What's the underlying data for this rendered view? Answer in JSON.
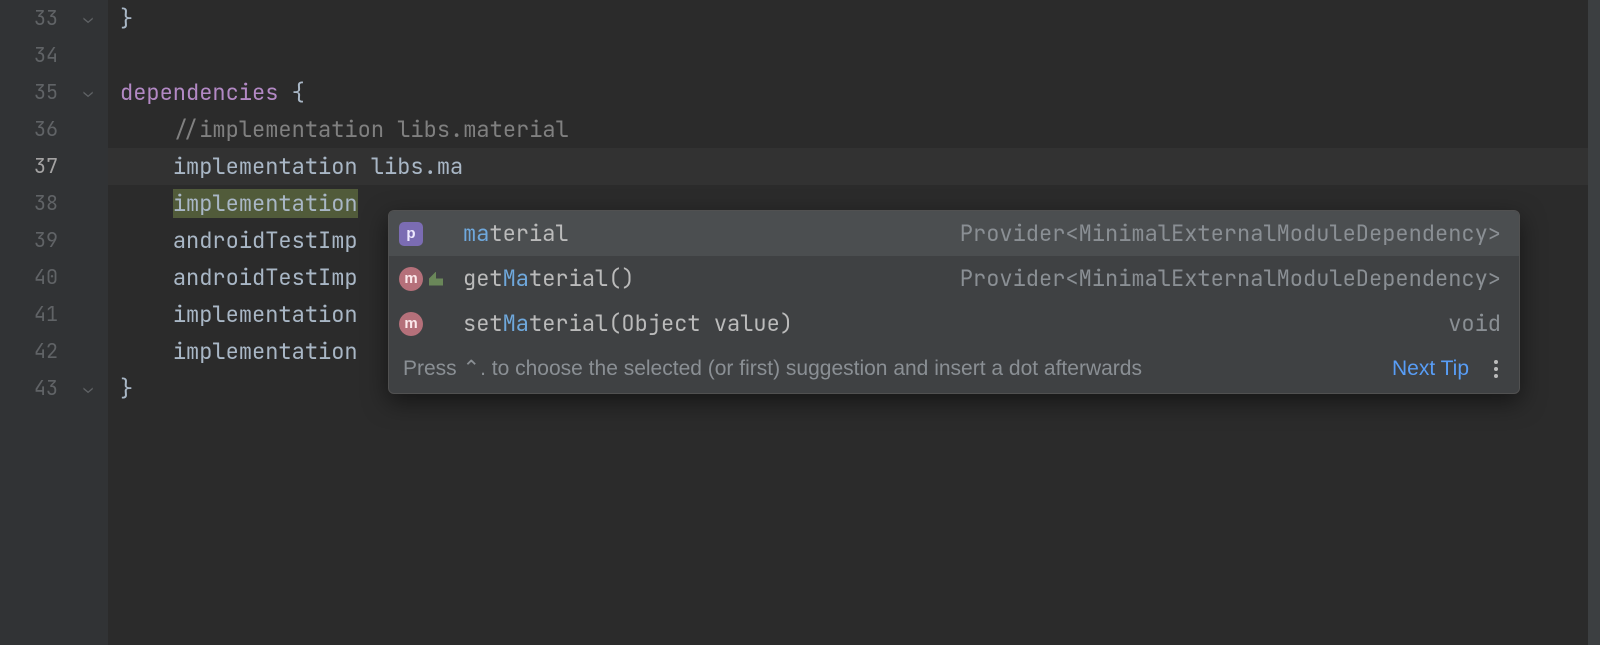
{
  "gutter": {
    "start": 33,
    "end": 43,
    "caret_line": 37
  },
  "code_lines": {
    "l33": "}",
    "l34": "",
    "l35_kw": "dependencies",
    "l35_rest": " {",
    "l36_comment": "//implementation libs.material",
    "l37_call": "implementation",
    "l37_arg": " libs.ma",
    "l38_sel": "implementation",
    "l39": "androidTestImp",
    "l40": "androidTestImp",
    "l41": "implementation",
    "l42": "implementation",
    "l43": "}"
  },
  "popup": {
    "rows": [
      {
        "icon": "p",
        "vis": false,
        "label_pre": "ma",
        "label_rest": "terial",
        "type": "Provider<MinimalExternalModuleDependency>",
        "selected": true
      },
      {
        "icon": "m",
        "vis": true,
        "label_pre": "get",
        "label_match": "Ma",
        "label_rest": "terial()",
        "type": "Provider<MinimalExternalModuleDependency>",
        "selected": false
      },
      {
        "icon": "m",
        "vis": false,
        "label_pre": "set",
        "label_match": "Ma",
        "label_rest": "terial(Object value)",
        "type": "void",
        "selected": false
      }
    ],
    "hint_text": "Press ⌃. to choose the selected (or first) suggestion and insert a dot afterwards",
    "next_tip": "Next Tip"
  }
}
